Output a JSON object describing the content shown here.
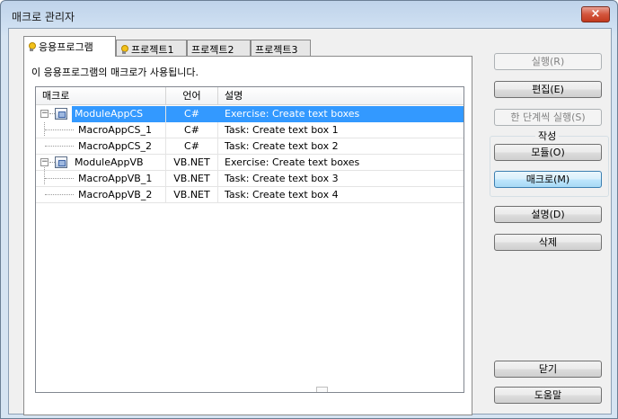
{
  "window": {
    "title": "매크로 관리자",
    "close_glyph": "×"
  },
  "tabs": [
    {
      "label": "응용프로그램",
      "icon": "bulb-icon"
    },
    {
      "label": "프로젝트1",
      "icon": "bulb-icon"
    },
    {
      "label": "프로젝트2"
    },
    {
      "label": "프로젝트3"
    }
  ],
  "panel": {
    "description": "이 응용프로그램의 매크로가 사용됩니다."
  },
  "columns": [
    "매크로",
    "언어",
    "설명"
  ],
  "rows": [
    {
      "name": "ModuleAppCS",
      "lang": "C#",
      "desc": "Exercise: Create text boxes"
    },
    {
      "name": "MacroAppCS_1",
      "lang": "C#",
      "desc": "Task: Create text box 1"
    },
    {
      "name": "MacroAppCS_2",
      "lang": "C#",
      "desc": "Task: Create text box 2"
    },
    {
      "name": "ModuleAppVB",
      "lang": "VB.NET",
      "desc": "Exercise: Create text boxes"
    },
    {
      "name": "MacroAppVB_1",
      "lang": "VB.NET",
      "desc": "Task: Create text box 3"
    },
    {
      "name": "MacroAppVB_2",
      "lang": "VB.NET",
      "desc": "Task: Create text box 4"
    }
  ],
  "buttons": {
    "run": "실행(R)",
    "edit": "편집(E)",
    "step": "한 단계씩 실행(S)",
    "create_group": "작성",
    "module": "모듈(O)",
    "macro": "매크로(M)",
    "description": "설명(D)",
    "delete": "삭제",
    "close": "닫기",
    "help": "도움말"
  },
  "colors": {
    "selection": "#3399ff",
    "close_button": "#c9452a"
  }
}
